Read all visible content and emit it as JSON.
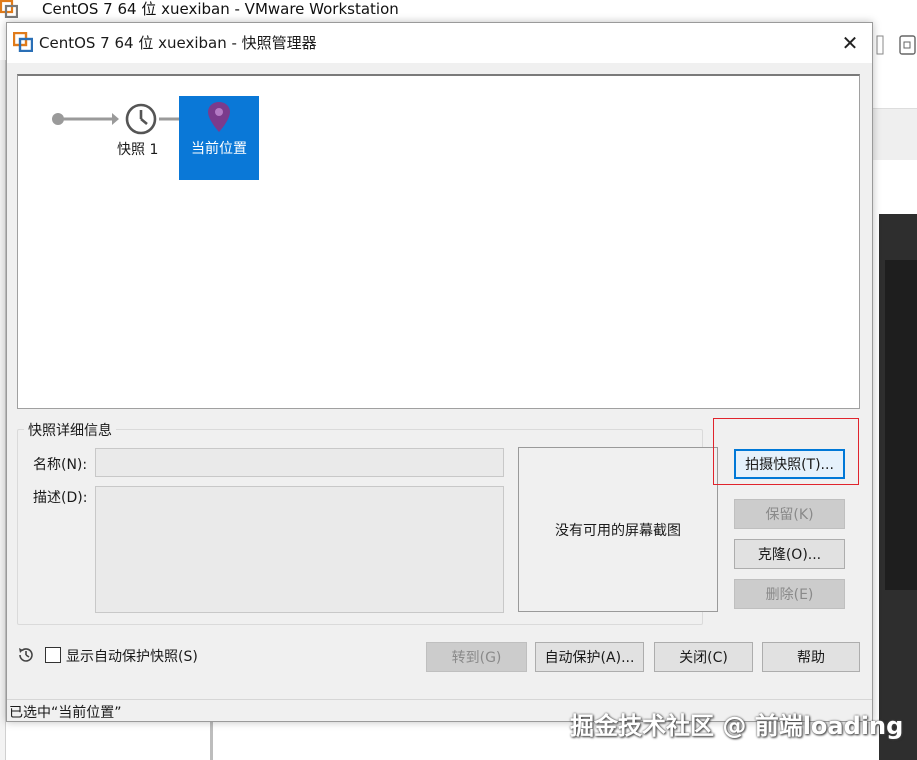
{
  "parent_window": {
    "title": "CentOS 7 64 位 xuexiban - VMware Workstation"
  },
  "dialog": {
    "title": "CentOS 7 64 位 xuexiban - 快照管理器",
    "tree": {
      "snapshot_node_label": "快照 1",
      "current_node_label": "当前位置"
    },
    "details": {
      "legend": "快照详细信息",
      "name_label": "名称(N):",
      "name_value": "",
      "desc_label": "描述(D):",
      "desc_value": "",
      "screenshot_placeholder": "没有可用的屏幕截图"
    },
    "side_buttons": {
      "take_snapshot": "拍摄快照(T)...",
      "keep": "保留(K)",
      "clone": "克隆(O)...",
      "delete": "删除(E)"
    },
    "bottom": {
      "show_autoprotect_label": "显示自动保护快照(S)",
      "show_autoprotect_checked": false,
      "goto": "转到(G)",
      "autoprotect": "自动保护(A)...",
      "close": "关闭(C)",
      "help": "帮助"
    },
    "status": "已选中“当前位置”"
  },
  "watermark": "掘金技术社区 @ 前端loading",
  "colors": {
    "accent": "#0a78d7",
    "highlight": "#e0242c"
  }
}
